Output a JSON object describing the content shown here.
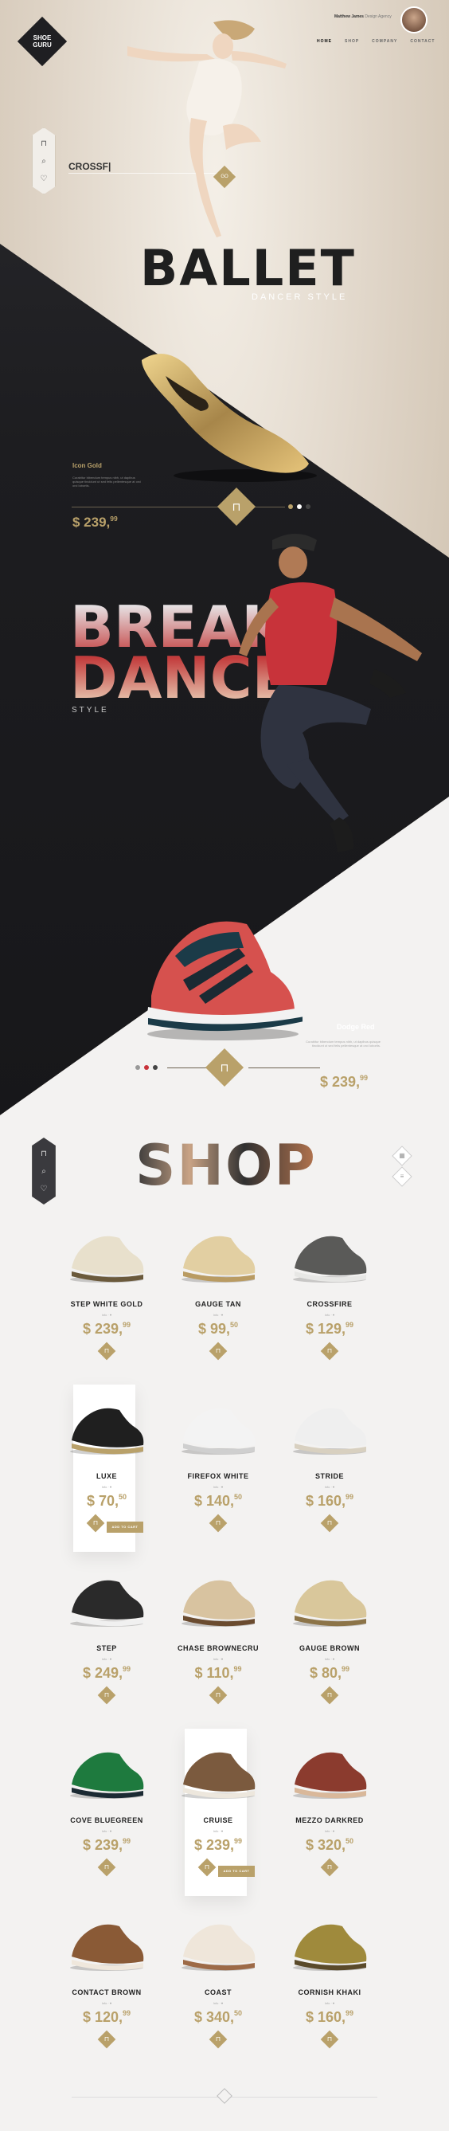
{
  "brand": {
    "logo_text": "SHOE GURU"
  },
  "header": {
    "user_name": "Matthew James",
    "user_meta": "Design Agency",
    "nav": [
      {
        "label": "HOME"
      },
      {
        "label": "SHOP"
      },
      {
        "label": "COMPANY"
      },
      {
        "label": "CONTACT"
      }
    ]
  },
  "search": {
    "value": "CROSSF|",
    "button_label": "GO"
  },
  "hero_ballet": {
    "title": "BALLET",
    "subtitle": "DANCER STYLE",
    "product_name": "Icon Gold",
    "product_desc": "Curabitur bibendum tempus nibh, ut dapibus quisque tincidunt ut sed felis pellentesque at orci orci lobortis.",
    "price_main": "$ 239,",
    "price_cents": "99"
  },
  "hero_break": {
    "title_line1": "BREAK",
    "title_line2": "DANCE",
    "subtitle": "STYLE",
    "product_name": "Dodge Red",
    "product_desc": "Curabitur bibendum tempus nibh, ut dapibus quisque tincidunt ut sed felis pellentesque at orci lobortis.",
    "price_main": "$ 239,",
    "price_cents": "99"
  },
  "shop": {
    "title": "SHOP",
    "add_to_cart": "ADD TO CART",
    "meta": "Info  ·  ♥",
    "items": [
      {
        "name": "STEP WHITE GOLD",
        "price_main": "$ 239,",
        "price_cents": "99"
      },
      {
        "name": "GAUGE TAN",
        "price_main": "$ 99,",
        "price_cents": "50"
      },
      {
        "name": "CROSSFIRE",
        "price_main": "$ 129,",
        "price_cents": "99"
      },
      {
        "name": "LUXE",
        "price_main": "$ 70,",
        "price_cents": "50"
      },
      {
        "name": "FIREFOX WHITE",
        "price_main": "$ 140,",
        "price_cents": "50"
      },
      {
        "name": "STRIDE",
        "price_main": "$ 160,",
        "price_cents": "99"
      },
      {
        "name": "STEP",
        "price_main": "$ 249,",
        "price_cents": "99"
      },
      {
        "name": "CHASE BROWNECRU",
        "price_main": "$ 110,",
        "price_cents": "99"
      },
      {
        "name": "GAUGE BROWN",
        "price_main": "$ 80,",
        "price_cents": "99"
      },
      {
        "name": "COVE BLUEGREEN",
        "price_main": "$ 239,",
        "price_cents": "99"
      },
      {
        "name": "CRUISE",
        "price_main": "$ 239,",
        "price_cents": "99"
      },
      {
        "name": "MEZZO DARKRED",
        "price_main": "$ 320,",
        "price_cents": "50"
      },
      {
        "name": "CONTACT BROWN",
        "price_main": "$ 120,",
        "price_cents": "99"
      },
      {
        "name": "COAST",
        "price_main": "$ 340,",
        "price_cents": "50"
      },
      {
        "name": "CORNISH KHAKI",
        "price_main": "$ 160,",
        "price_cents": "99"
      }
    ]
  }
}
